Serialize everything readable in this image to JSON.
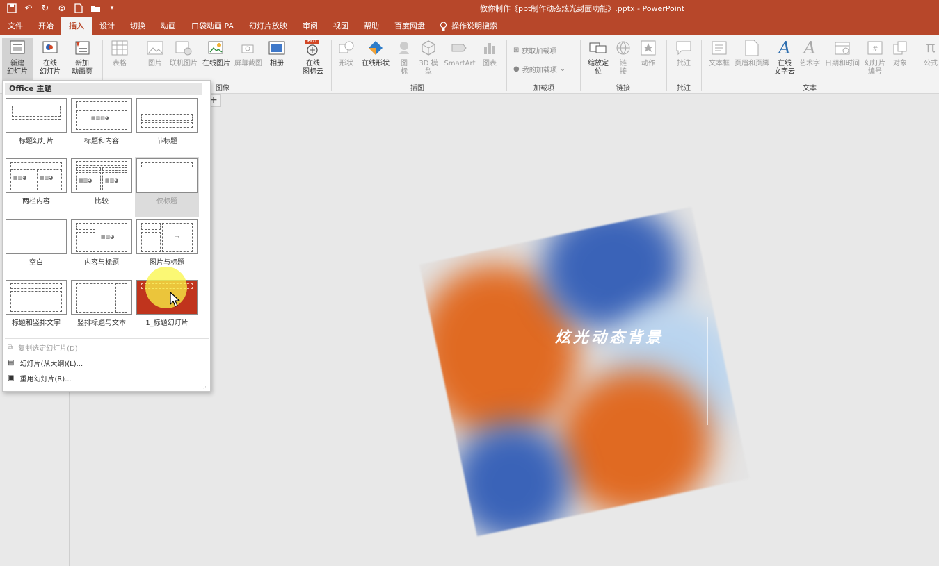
{
  "window": {
    "title": "教你制作《ppt制作动态炫光封面功能》.pptx  -  PowerPoint"
  },
  "tabs": [
    "文件",
    "开始",
    "插入",
    "设计",
    "切换",
    "动画",
    "口袋动画 PA",
    "幻灯片放映",
    "审阅",
    "视图",
    "帮助",
    "百度网盘"
  ],
  "active_tab": "插入",
  "tell_me": "操作说明搜索",
  "ribbon": {
    "new_slide": [
      "新建",
      "幻灯片"
    ],
    "online_slide": [
      "在线",
      "幻灯片"
    ],
    "new_anim_page": [
      "新加",
      "动画页"
    ],
    "table": "表格",
    "picture": "图片",
    "online_picture_link": "联机图片",
    "online_picture": "在线图片",
    "screenshot": "屏幕截图",
    "album": "相册",
    "online_icon_cloud": [
      "在线",
      "图标云"
    ],
    "shapes": "形状",
    "online_shapes": "在线形状",
    "icons": [
      "图",
      "标"
    ],
    "model_3d": [
      "3D 模",
      "型"
    ],
    "smartart": "SmartArt",
    "chart": "图表",
    "get_addins": "获取加载项",
    "my_addins": "我的加载项",
    "zoom": [
      "缩放定",
      "位"
    ],
    "link": [
      "链",
      "接"
    ],
    "action": "动作",
    "comment": "批注",
    "textbox": "文本框",
    "header_footer": "页眉和页脚",
    "online_wordcloud": [
      "在线",
      "文字云"
    ],
    "wordart": "艺术字",
    "datetime": "日期和时间",
    "slide_number": [
      "幻灯片",
      "编号"
    ],
    "object": "对象",
    "formula": "公式",
    "groups": {
      "image": "图像",
      "illustration": "插图",
      "addins": "加载项",
      "links": "链接",
      "comments": "批注",
      "text": "文本"
    },
    "hot_badge": "HOT"
  },
  "dropdown": {
    "header": "Office 主题",
    "layouts": [
      "标题幻灯片",
      "标题和内容",
      "节标题",
      "两栏内容",
      "比较",
      "仅标题",
      "空白",
      "内容与标题",
      "图片与标题",
      "标题和竖排文字",
      "竖排标题与文本",
      "1_标题幻灯片"
    ],
    "menu": [
      "复制选定幻灯片(D)",
      "幻灯片(从大纲)(L)...",
      "重用幻灯片(R)..."
    ]
  },
  "slide": {
    "title": "炫光动态背景"
  },
  "colors": {
    "accent": "#b7472a",
    "blob_orange": "#e06a22",
    "blob_blue": "#3a63b8",
    "blob_lightblue": "#b9d4ef"
  }
}
